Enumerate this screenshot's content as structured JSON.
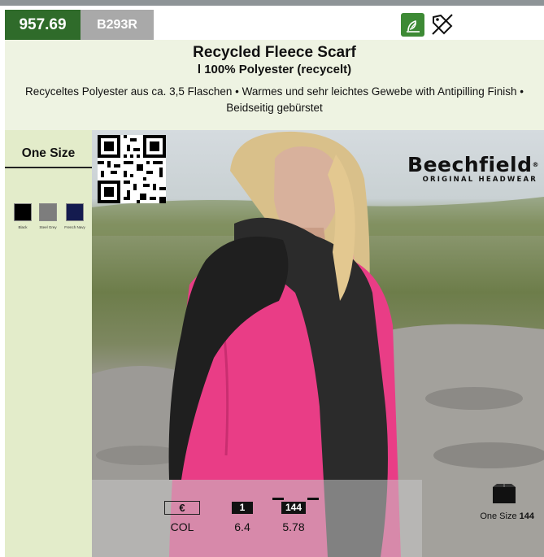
{
  "header": {
    "article_number": "957.69",
    "brand_code": "B293R",
    "icons": [
      "eco-leaf-icon",
      "no-discount-tag-icon"
    ]
  },
  "product": {
    "title": "Recycled Fleece Scarf",
    "subtitle": "l 100% Polyester (recycelt)",
    "description": "Recyceltes Polyester aus ca. 3,5 Flaschen • Warmes und sehr leichtes Gewebe with Antipilling Finish • Beidseitig gebürstet"
  },
  "sizes": {
    "label": "One Size"
  },
  "colors": [
    {
      "name": "Black",
      "hex": "#000000"
    },
    {
      "name": "Steel Grey",
      "hex": "#7d7d7d"
    },
    {
      "name": "French Navy",
      "hex": "#141b4f"
    }
  ],
  "brand": {
    "name": "Beechfield",
    "tagline": "ORIGINAL HEADWEAR"
  },
  "pricing": {
    "currency_symbol": "€",
    "col_label": "COL",
    "qty_label": "1",
    "qty_price": "6.4",
    "carton_label": "144",
    "carton_price": "5.78"
  },
  "stock": {
    "size": "One Size",
    "quantity": "144"
  },
  "theme": {
    "green_dark": "#2f6b2a",
    "grey_badge": "#a9a9a9",
    "sidebar_bg": "#e3ecca",
    "title_bg": "#eef3e2"
  }
}
